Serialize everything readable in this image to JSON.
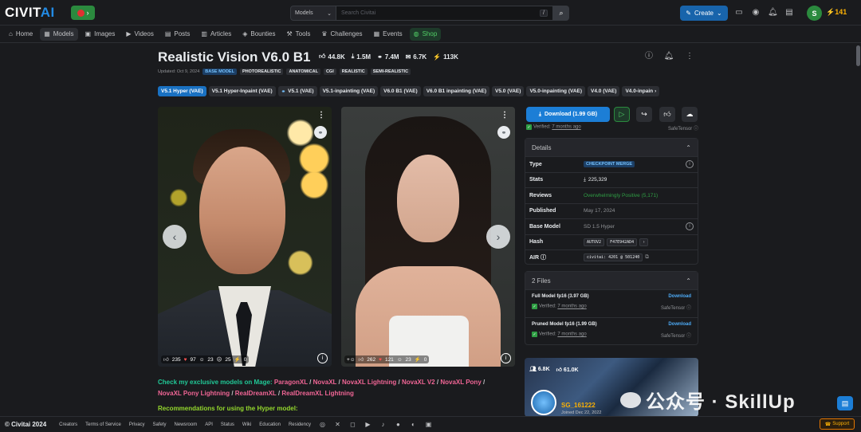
{
  "header": {
    "logo_left": "CIVIT",
    "logo_right": "AI",
    "search_scope": "Models",
    "search_placeholder": "Search Civitai",
    "search_shortcut": "/",
    "create_label": "Create",
    "user_initial": "S",
    "buzz": "141"
  },
  "nav": [
    {
      "label": "Home",
      "icon": "home-icon"
    },
    {
      "label": "Models",
      "icon": "models-icon"
    },
    {
      "label": "Images",
      "icon": "images-icon"
    },
    {
      "label": "Videos",
      "icon": "videos-icon"
    },
    {
      "label": "Posts",
      "icon": "posts-icon"
    },
    {
      "label": "Articles",
      "icon": "articles-icon"
    },
    {
      "label": "Bounties",
      "icon": "bounties-icon"
    },
    {
      "label": "Tools",
      "icon": "tools-icon"
    },
    {
      "label": "Challenges",
      "icon": "challenges-icon"
    },
    {
      "label": "Events",
      "icon": "events-icon"
    },
    {
      "label": "Shop",
      "icon": "shop-icon"
    }
  ],
  "model": {
    "title": "Realistic Vision V6.0 B1",
    "stats": {
      "likes": "44.8K",
      "downloads": "1.5M",
      "links": "7.4M",
      "comments": "6.7K",
      "buzz": "113K"
    },
    "updated": "Updated: Oct 9, 2024",
    "tags": [
      "BASE MODEL",
      "PHOTOREALISTIC",
      "ANATOMICAL",
      "CGI",
      "REALISTIC",
      "SEMI-REALISTIC"
    ]
  },
  "versions": [
    "V5.1 Hyper (VAE)",
    "V5.1 Hyper-Inpaint (VAE)",
    "V5.1 (VAE)",
    "V5.1-inpainting (VAE)",
    "V6.0 B1 (VAE)",
    "V6.0 B1 inpainting (VAE)",
    "V5.0 (VAE)",
    "V5.0-inpainting (VAE)",
    "V4.0 (VAE)",
    "V4.0-inpain"
  ],
  "images": [
    {
      "reactions": [
        "235",
        "97",
        "23",
        "25",
        "0"
      ]
    },
    {
      "reactions": [
        "262",
        "121",
        "23",
        "0"
      ]
    }
  ],
  "description": {
    "lead": "Check my exclusive models on Mage:",
    "links": [
      "ParagonXL",
      "NovaXL",
      "NovaXL Lightning",
      "NovaXL V2",
      "NovaXL Pony",
      "NovaXL Pony Lightning",
      "RealDreamXL",
      "RealDreamXL Lightning"
    ],
    "sep": "/",
    "rec": "Recommendations for using the Hyper model:"
  },
  "download": {
    "label": "Download (1.99 GB)",
    "verified_prefix": "Verified:",
    "verified_time": "7 months ago",
    "format": "SafeTensor"
  },
  "details": {
    "title": "Details",
    "rows": [
      {
        "label": "Type",
        "value": "CHECKPOINT MERGE"
      },
      {
        "label": "Stats",
        "value": "225,329"
      },
      {
        "label": "Reviews",
        "value": "Overwhelmingly Positive (5,171)"
      },
      {
        "label": "Published",
        "value": "May 17, 2024"
      },
      {
        "label": "Base Model",
        "value": "SD 1.5 Hyper"
      },
      {
        "label": "Hash",
        "value_a": "AUTOV2",
        "value_b": "F47E942AD4"
      },
      {
        "label": "AIR",
        "value": "civitai: 4201 @ 501240"
      }
    ]
  },
  "files": {
    "title": "2 Files",
    "items": [
      {
        "name": "Full Model fp16 (3.97 GB)",
        "action": "Download",
        "verified": "Verified:",
        "time": "7 months ago",
        "format": "SafeTensor"
      },
      {
        "name": "Pruned Model fp16 (1.99 GB)",
        "action": "Download",
        "verified": "Verified:",
        "time": "7 months ago",
        "format": "SafeTensor"
      }
    ]
  },
  "creator": {
    "followers": "6.8K",
    "likes": "61.0K",
    "name": "SG_161222",
    "joined": "Joined Dec 22, 2022"
  },
  "watermark": "公众号 · SkillUp",
  "footer": {
    "copyright": "© Civitai 2024",
    "links": [
      "Creators",
      "Terms of Service",
      "Privacy",
      "Safety",
      "Newsroom",
      "API",
      "Status",
      "Wiki",
      "Education",
      "Residency"
    ],
    "support": "Support"
  }
}
